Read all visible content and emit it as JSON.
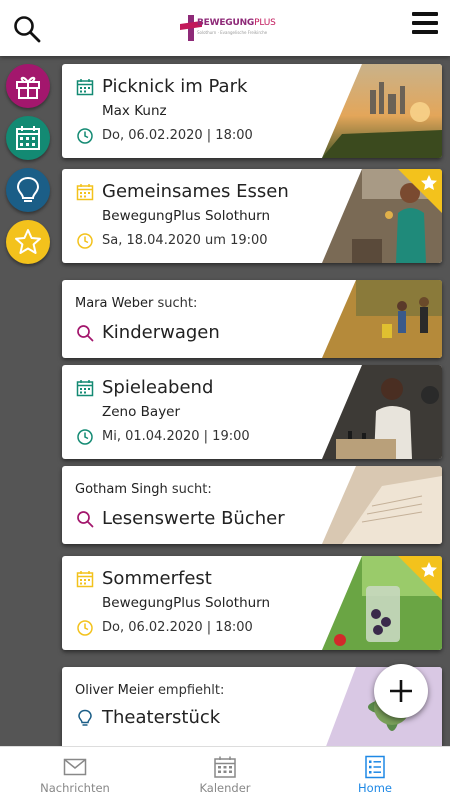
{
  "header": {
    "brand": "BEWEGUNG",
    "brand_plus": "PLUS",
    "brand_sub": "Solothurn · Evangelische Freikirche"
  },
  "rail": {
    "items": [
      {
        "icon": "gift-icon",
        "color": "#a3176d"
      },
      {
        "icon": "calendar-icon",
        "color": "#138a73"
      },
      {
        "icon": "lightbulb-icon",
        "color": "#1b5e87"
      },
      {
        "icon": "star-icon",
        "color": "#f3c21c"
      }
    ]
  },
  "feed": {
    "cards": [
      {
        "kind": "event",
        "title": "Picknick im Park",
        "subtitle": "Max Kunz",
        "date": "Do, 06.02.2020 | 18:00",
        "accent": "#138a73"
      },
      {
        "kind": "event",
        "title": "Gemeinsames Essen",
        "subtitle": "BewegungPlus Solothurn",
        "date": "Sa, 18.04.2020 um 19:00",
        "accent": "#f3c21c",
        "starred": true
      },
      {
        "kind": "search",
        "user": "Mara Weber",
        "verb": "sucht:",
        "item": "Kinderwagen",
        "accent": "#a3176d"
      },
      {
        "kind": "event",
        "title": "Spieleabend",
        "subtitle": "Zeno Bayer",
        "date": "Mi, 01.04.2020 | 19:00",
        "accent": "#138a73"
      },
      {
        "kind": "search",
        "user": "Gotham Singh",
        "verb": "sucht:",
        "item": "Lesenswerte Bücher",
        "accent": "#a3176d"
      },
      {
        "kind": "event",
        "title": "Sommerfest",
        "subtitle": "BewegungPlus Solothurn",
        "date": "Do, 06.02.2020 | 18:00",
        "accent": "#f3c21c",
        "starred": true
      },
      {
        "kind": "recommend",
        "user": "Oliver Meier",
        "verb": "empfiehlt:",
        "item": "Theaterstück",
        "accent": "#1b5e87"
      }
    ]
  },
  "bottom_nav": {
    "items": [
      {
        "label": "Nachrichten",
        "icon": "mail-icon"
      },
      {
        "label": "Kalender",
        "icon": "calendar-icon"
      },
      {
        "label": "Home",
        "icon": "home-list-icon",
        "active": true
      }
    ],
    "accent": "#1e88e5"
  }
}
